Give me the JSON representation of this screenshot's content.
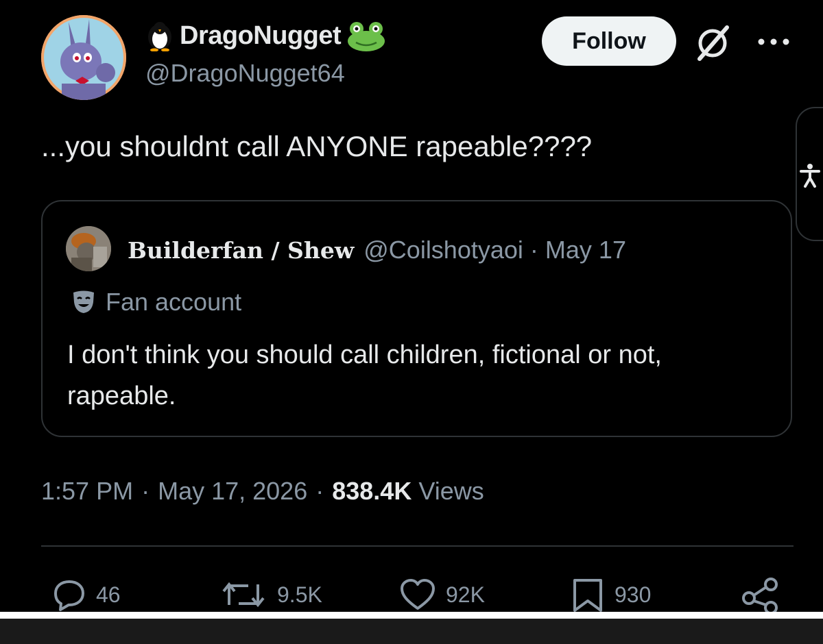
{
  "author": {
    "display_name": "DragoNugget",
    "handle": "@DragoNugget64",
    "name_emoji_left": "penguin-icon",
    "name_emoji_right": "frog-icon"
  },
  "header": {
    "follow_label": "Follow",
    "grok_icon": "grok-icon",
    "more_icon": "more-icon"
  },
  "tweet": {
    "text": "...you shouldnt call ANYONE rapeable????"
  },
  "quote": {
    "display_name": "Builderfan / Shew",
    "handle": "@Coilshotyaoi",
    "separator": "·",
    "date": "May 17",
    "badge_label": "Fan account",
    "text": "I don't think you should call children, fictional or not, rapeable."
  },
  "meta": {
    "time": "1:57 PM",
    "separator": "·",
    "date": "May 17, 2026",
    "views_count": "838.4K",
    "views_label": "Views"
  },
  "actions": {
    "replies": "46",
    "reposts": "9.5K",
    "likes": "92K",
    "bookmarks": "930"
  },
  "colors": {
    "background": "#000000",
    "text_primary": "#e7e9ea",
    "text_secondary": "#8b98a5",
    "border": "#2f3336",
    "follow_bg": "#eff3f4"
  }
}
